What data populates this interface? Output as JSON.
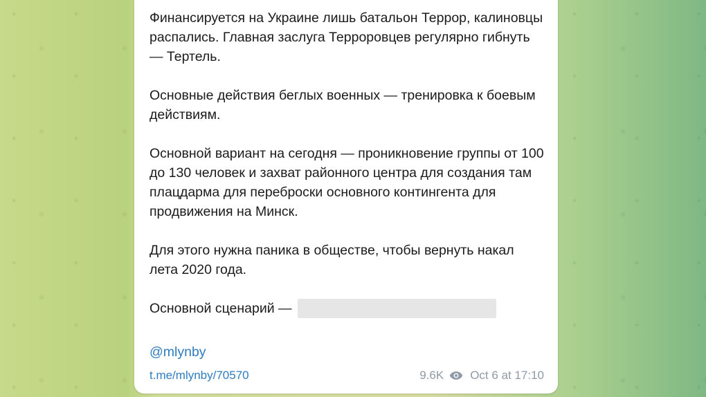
{
  "message": {
    "paragraphs": [
      "Финансируется на Украине лишь батальон Террор, калиновцы распались. Главная заслуга Террорoвцев регулярно гибнуть — Тертель.",
      "Основные действия беглых военных — тренировка к боевым действиям.",
      "Основной вариант на сегодня — проникновение группы от 100 до 130 человек и захват районного центра для создания там плацдарма для переброски основного контингента для продвижения на Минск.",
      "Для этого нужна паника в обществе, чтобы вернуть накал лета 2020 года."
    ],
    "scenario_label": "Основной сценарий —",
    "channel_handle": "@mlynby",
    "post_link": "t.me/mlynby/70570",
    "views": "9.6K",
    "timestamp": "Oct 6 at 17:10"
  },
  "icons": {
    "views": "eye-icon"
  },
  "colors": {
    "link": "#2f7cc0",
    "meta": "#8e9aa6",
    "bubble": "#ffffff"
  }
}
